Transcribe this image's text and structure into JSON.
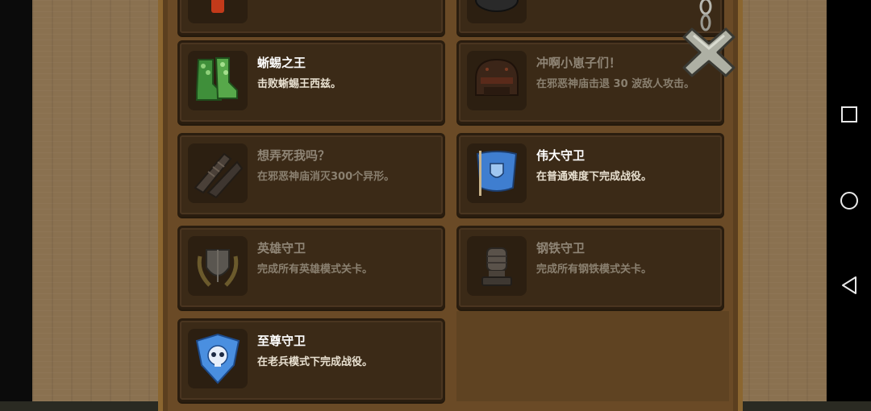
{
  "achievements": [
    {
      "title": "蜥蜴之王",
      "desc": "击败蜥蜴王西兹。",
      "icon": "green-boots-icon",
      "unlocked": true
    },
    {
      "title": "冲啊小崽子们！",
      "desc": "在邪恶神庙击退 30 波敌人攻击。",
      "icon": "dark-helmet-icon",
      "unlocked": false
    },
    {
      "title": "想弄死我吗？",
      "desc": "在邪恶神庙消灭300个异形。",
      "icon": "claw-icon",
      "unlocked": false
    },
    {
      "title": "伟大守卫",
      "desc": "在普通难度下完成战役。",
      "icon": "blue-shield-flag-icon",
      "unlocked": true
    },
    {
      "title": "英雄守卫",
      "desc": "完成所有英雄模式关卡。",
      "icon": "laurel-shield-icon",
      "unlocked": false
    },
    {
      "title": "钢铁守卫",
      "desc": "完成所有钢铁模式关卡。",
      "icon": "iron-fist-icon",
      "unlocked": false
    },
    {
      "title": "至尊守卫",
      "desc": "在老兵模式下完成战役。",
      "icon": "skull-flag-icon",
      "unlocked": true
    }
  ],
  "colors": {
    "panel": "#5b3f1f",
    "card": "#3b2a17",
    "title_unlocked": "#ffffff",
    "title_locked": "#8f8576"
  },
  "nav": {
    "recent": "square-icon",
    "home": "circle-icon",
    "back": "triangle-back-icon"
  }
}
